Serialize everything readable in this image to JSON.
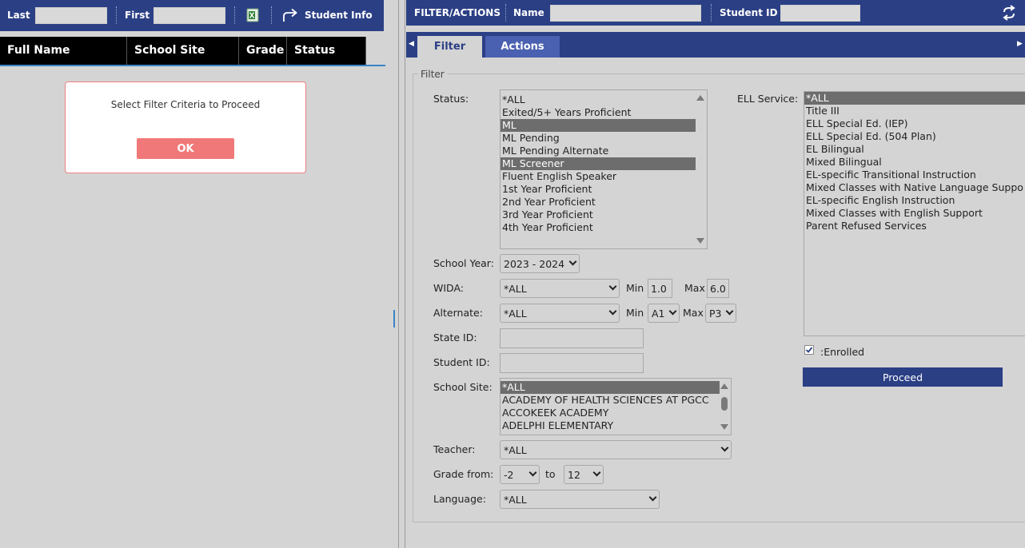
{
  "left": {
    "last_label": "Last",
    "first_label": "First",
    "student_info_label": "Student Info",
    "excel_icon": "excel-icon",
    "columns": [
      "Full Name",
      "School Site",
      "Grade",
      "Status"
    ],
    "dialog": {
      "message": "Select Filter Criteria to Proceed",
      "ok_label": "OK"
    }
  },
  "right": {
    "header": {
      "title": "FILTER/ACTIONS",
      "name_label": "Name",
      "student_id_label": "Student ID"
    },
    "tabs": [
      {
        "label": "Filter",
        "active": true
      },
      {
        "label": "Actions",
        "active": false
      }
    ],
    "filter": {
      "legend": "Filter",
      "status": {
        "label": "Status:",
        "options": [
          "*ALL",
          "Exited/5+ Years Proficient",
          "ML",
          "ML Pending",
          "ML Pending Alternate",
          "ML Screener",
          "Fluent English Speaker",
          "1st Year Proficient",
          "2nd Year Proficient",
          "3rd Year Proficient",
          "4th Year Proficient"
        ],
        "selected": [
          "ML",
          "ML Screener"
        ]
      },
      "school_year": {
        "label": "School Year:",
        "value": "2023 - 2024"
      },
      "wida": {
        "label": "WIDA:",
        "value": "*ALL",
        "min_label": "Min",
        "min_value": "1.0",
        "max_label": "Max",
        "max_value": "6.0"
      },
      "alternate": {
        "label": "Alternate:",
        "value": "*ALL",
        "min_label": "Min",
        "min_value": "A1",
        "max_label": "Max",
        "max_value": "P3"
      },
      "state_id": {
        "label": "State ID:",
        "value": ""
      },
      "student_id": {
        "label": "Student ID:",
        "value": ""
      },
      "school_site": {
        "label": "School Site:",
        "options": [
          "*ALL",
          "ACADEMY OF HEALTH SCIENCES AT PGCC",
          "ACCOKEEK ACADEMY",
          "ADELPHI ELEMENTARY"
        ],
        "selected": [
          "*ALL"
        ]
      },
      "teacher": {
        "label": "Teacher:",
        "value": "*ALL"
      },
      "grade": {
        "label": "Grade from:",
        "from": "-2",
        "to_label": "to",
        "to": "12"
      },
      "language": {
        "label": "Language:",
        "value": "*ALL"
      },
      "ell_service": {
        "label": "ELL Service:",
        "options": [
          "*ALL",
          "Title III",
          "ELL Special Ed. (IEP)",
          "ELL Special Ed. (504 Plan)",
          "EL Bilingual",
          "Mixed Bilingual",
          "EL-specific Transitional Instruction",
          "Mixed Classes with Native Language Suppo",
          "EL-specific English Instruction",
          "Mixed Classes with English Support",
          "Parent Refused Services"
        ],
        "selected": [
          "*ALL"
        ]
      },
      "enrolled": {
        "label": ":Enrolled",
        "checked": true
      },
      "proceed_label": "Proceed"
    }
  },
  "colors": {
    "header_blue": "#2b3f85",
    "tab_inactive": "#4a60b0",
    "dialog_button": "#f07878",
    "panel_bg": "#d4d4d4",
    "selected_option": "#6d6d6d"
  }
}
